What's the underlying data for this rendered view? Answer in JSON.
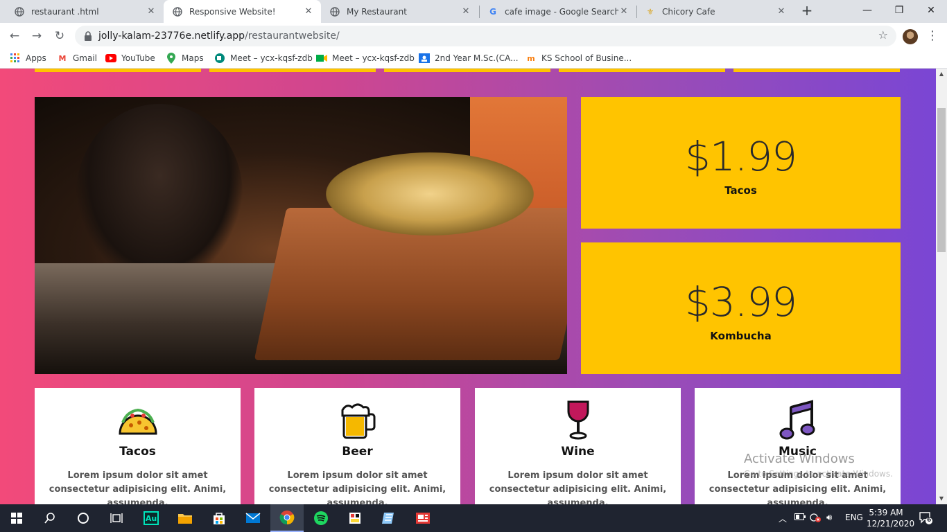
{
  "browser": {
    "tabs": [
      {
        "title": "restaurant .html",
        "icon": "globe-icon"
      },
      {
        "title": "Responsive Website!",
        "icon": "globe-icon",
        "active": true
      },
      {
        "title": "My Restaurant",
        "icon": "globe-icon"
      },
      {
        "title": "cafe image - Google Search",
        "icon": "google-icon"
      },
      {
        "title": "Chicory Cafe",
        "icon": "fleur-de-lis-icon"
      }
    ],
    "url_host": "jolly-kalam-23776e.netlify.app",
    "url_path": "/restaurantwebsite/",
    "bookmarks": [
      "Apps",
      "Gmail",
      "YouTube",
      "Maps",
      "Meet – ycx-kqsf-zdb",
      "Meet – ycx-kqsf-zdb",
      "2nd Year M.Sc.(CA...",
      "KS School of Busine..."
    ]
  },
  "page": {
    "prices": [
      {
        "amount": "$1.99",
        "label": "Tacos"
      },
      {
        "amount": "$3.99",
        "label": "Kombucha"
      }
    ],
    "cards": [
      {
        "title": "Tacos",
        "icon": "taco-icon",
        "desc": "Lorem ipsum dolor sit amet consectetur adipisicing elit. Animi, assumenda."
      },
      {
        "title": "Beer",
        "icon": "beer-mug-icon",
        "desc": "Lorem ipsum dolor sit amet consectetur adipisicing elit. Animi, assumenda."
      },
      {
        "title": "Wine",
        "icon": "wine-glass-icon",
        "desc": "Lorem ipsum dolor sit amet consectetur adipisicing elit. Animi, assumenda."
      },
      {
        "title": "Music",
        "icon": "music-note-icon",
        "desc": "Lorem ipsum dolor sit amet consectetur adipisicing elit. Animi, assumenda."
      }
    ],
    "colors": {
      "accent": "#ffc400",
      "gradient_start": "#f24a7a",
      "gradient_end": "#7a46d4"
    }
  },
  "watermark": {
    "line1": "Activate Windows",
    "line2": "Go to Settings to activate Windows."
  },
  "taskbar": {
    "lang": "ENG",
    "time": "5:39 AM",
    "date": "12/21/2020",
    "notifications": "6"
  }
}
